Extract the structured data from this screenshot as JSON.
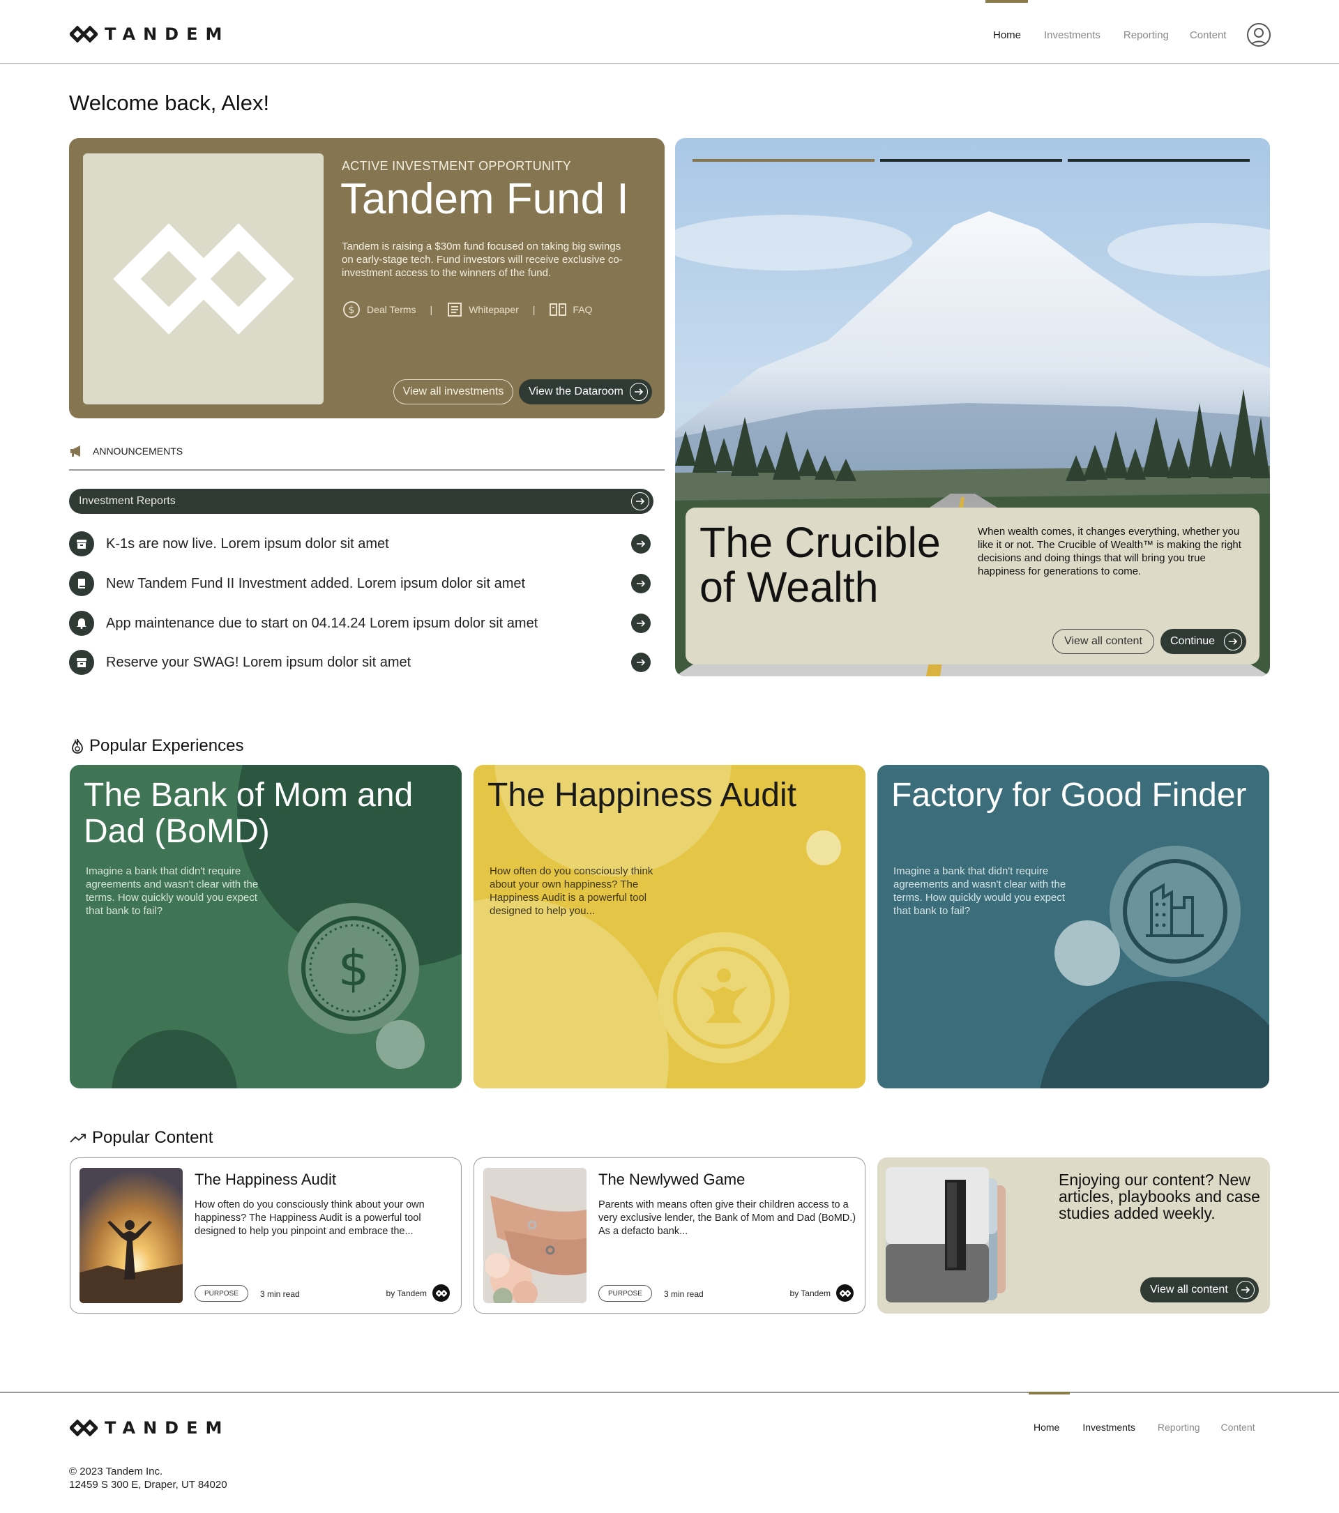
{
  "header": {
    "brand": "TANDEM",
    "nav": [
      {
        "label": "Home",
        "active": true
      },
      {
        "label": "Investments",
        "active": false
      },
      {
        "label": "Reporting",
        "active": false
      },
      {
        "label": "Content",
        "active": false
      }
    ],
    "profile_icon": "user-circle-icon"
  },
  "welcome": "Welcome back, Alex!",
  "fund": {
    "kicker": "ACTIVE INVESTMENT OPPORTUNITY",
    "title": "Tandem Fund I",
    "description": "Tandem is raising a $30m fund focused on taking big swings on early-stage tech. Fund investors will receive exclusive co-investment access to the winners of the fund.",
    "links": [
      {
        "label": "Deal Terms",
        "icon": "dollar-circle-icon"
      },
      {
        "label": "Whitepaper",
        "icon": "document-icon"
      },
      {
        "label": "FAQ",
        "icon": "book-icon"
      }
    ],
    "secondary_button": "View all investments",
    "primary_button": "View the Dataroom",
    "accent": "#857550",
    "logo_tile_color": "#dcdac8"
  },
  "announcements": {
    "heading": "ANNOUNCEMENTS",
    "icon": "megaphone-icon",
    "category": "Investment Reports",
    "items": [
      {
        "text": "K-1s are now live. Lorem ipsum dolor sit amet",
        "icon": "archive-icon"
      },
      {
        "text": "New Tandem Fund II Investment added. Lorem ipsum dolor sit amet",
        "icon": "book-icon"
      },
      {
        "text": "App maintenance due to start on 04.14.24 Lorem ipsum dolor sit amet",
        "icon": "bell-icon"
      },
      {
        "text": "Reserve your SWAG! Lorem ipsum dolor sit amet",
        "icon": "archive-icon"
      }
    ]
  },
  "hero": {
    "title": "The Crucible of Wealth",
    "description": "When wealth comes, it changes everything, whether you like it or not. The Crucible of Wealth™ is making the right decisions and doing things that will bring you true happiness for generations to come.",
    "secondary_button": "View all content",
    "primary_button": "Continue",
    "slides_total": 3,
    "slide_active": 1
  },
  "experiences": {
    "heading": "Popular Experiences",
    "icon": "flame-icon",
    "cards": [
      {
        "title": "The Bank of Mom and Dad (BoMD)",
        "description": "Imagine a bank that didn't require agreements and wasn't clear with the terms. How quickly would you expect that bank to fail?",
        "icon": "dollar-coin-icon",
        "color": "#3f7555"
      },
      {
        "title": "The Happiness Audit",
        "description": "How often do you consciously think about your own happiness? The Happiness Audit is a powerful tool designed to help you...",
        "icon": "happy-person-icon",
        "color": "#e4c545"
      },
      {
        "title": "Factory for Good Finder",
        "description": "Imagine a bank that didn't require agreements and wasn't clear with the terms. How quickly would you expect that bank to fail?",
        "icon": "factory-icon",
        "color": "#3b6e7a"
      }
    ]
  },
  "content": {
    "heading": "Popular Content",
    "icon": "trending-up-icon",
    "cards": [
      {
        "title": "The Happiness Audit",
        "description": "How often do you consciously think about your own happiness? The Happiness Audit is a powerful tool designed to help you pinpoint and embrace the...",
        "tag": "PURPOSE",
        "read": "3 min read",
        "by": "by Tandem"
      },
      {
        "title": "The Newlywed Game",
        "description": "Parents with means often give their children access to a very exclusive lender, the Bank of Mom and Dad (BoMD.) As a defacto bank...",
        "tag": "PURPOSE",
        "read": "3 min read",
        "by": "by Tandem"
      }
    ],
    "promo": {
      "text": "Enjoying our content? New articles, playbooks and case studies added weekly.",
      "button": "View all content"
    }
  },
  "footer": {
    "brand": "TANDEM",
    "nav": [
      {
        "label": "Home",
        "active": true
      },
      {
        "label": "Investments",
        "active": false
      },
      {
        "label": "Reporting",
        "active": false
      },
      {
        "label": "Content",
        "active": false
      }
    ],
    "copyright": "© 2023 Tandem Inc.",
    "address": "12459 S 300 E, Draper, UT 84020"
  }
}
